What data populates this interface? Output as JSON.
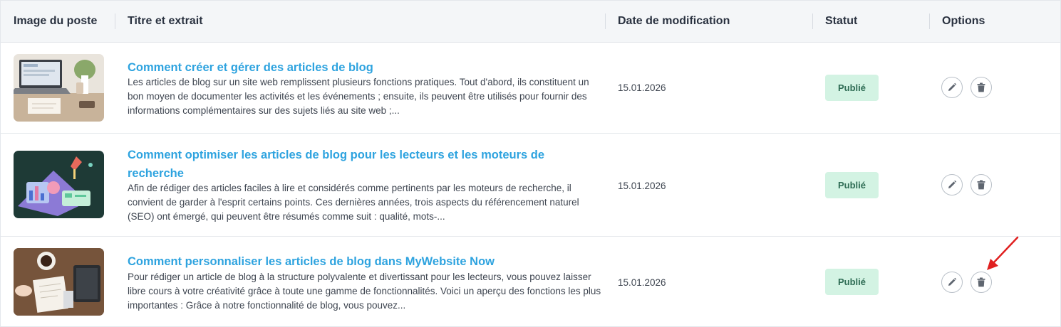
{
  "table": {
    "headers": {
      "image": "Image du poste",
      "title": "Titre et extrait",
      "date": "Date de modification",
      "status": "Statut",
      "options": "Options"
    },
    "rows": [
      {
        "thumbnail": "laptop-desk-photo",
        "title": "Comment créer et gérer des articles de blog",
        "excerpt": "Les articles de blog sur un site web remplissent plusieurs fonctions pratiques. Tout d'abord, ils constituent un bon moyen de documenter les activités et les événements ; ensuite, ils peuvent être utilisés pour fournir des informations complémentaires sur des sujets liés au site web ;...",
        "date": "15.01.2026",
        "status": "Publié"
      },
      {
        "thumbnail": "seo-illustration",
        "title": "Comment optimiser les articles de blog pour les lecteurs et les moteurs de recherche",
        "excerpt": "Afin de rédiger des articles faciles à lire et considérés comme pertinents par les moteurs de recherche, il convient de garder à l'esprit certains points. Ces dernières années, trois aspects du référencement naturel (SEO) ont émergé, qui peuvent être résumés comme suit : qualité, mots-...",
        "date": "15.01.2026",
        "status": "Publié"
      },
      {
        "thumbnail": "workspace-coffee-photo",
        "title": "Comment personnaliser les articles de blog dans MyWebsite Now",
        "excerpt": "Pour rédiger un article de blog à la structure polyvalente et divertissant pour les lecteurs, vous pouvez laisser libre cours à votre créativité grâce à toute une gamme de fonctionnalités. Voici un aperçu des fonctions les plus importantes : Grâce à notre fonctionnalité de blog, vous pouvez...",
        "date": "15.01.2026",
        "status": "Publié"
      }
    ]
  },
  "icons": {
    "edit": "pencil-icon",
    "delete": "trash-icon",
    "annotation": "red-arrow-pointer"
  },
  "colors": {
    "title_link": "#2ea3df",
    "badge_bg": "#d3f3e3",
    "badge_text": "#2e6c54",
    "header_bg": "#f4f6f8",
    "arrow": "#e02020"
  }
}
